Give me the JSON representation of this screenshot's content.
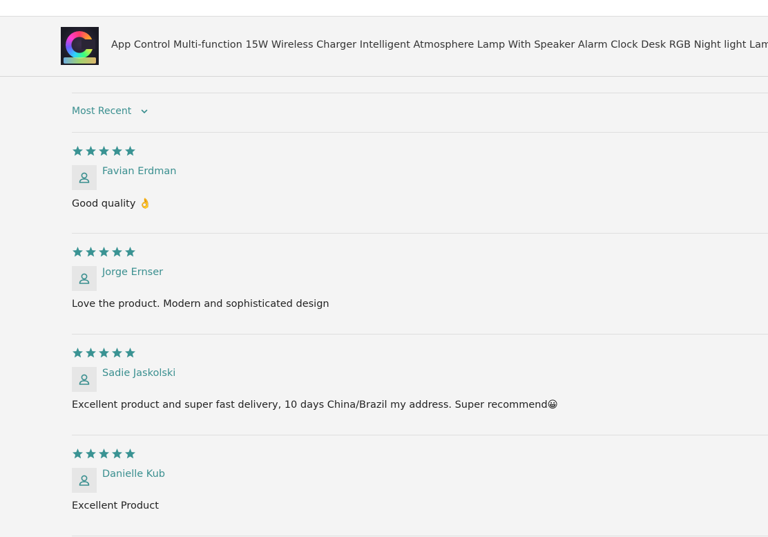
{
  "product": {
    "title": "App Control Multi-function 15W Wireless Charger Intelligent Atmosphere Lamp With Speaker Alarm Clock Desk RGB Night light Lamp"
  },
  "sort": {
    "label": "Most Recent"
  },
  "colors": {
    "accent": "#3a8f8f",
    "star": "#3a9393",
    "background": "#f4f4f4"
  },
  "reviews": [
    {
      "rating": 5,
      "author": "Favian Erdman",
      "text": "Good quality 👌"
    },
    {
      "rating": 5,
      "author": "Jorge Ernser",
      "text": "Love the product. Modern and sophisticated design"
    },
    {
      "rating": 5,
      "author": "Sadie Jaskolski",
      "text": "Excellent product and super fast delivery, 10 days China/Brazil my address. Super recommend😀"
    },
    {
      "rating": 5,
      "author": "Danielle Kub",
      "text": "Excellent Product"
    }
  ]
}
